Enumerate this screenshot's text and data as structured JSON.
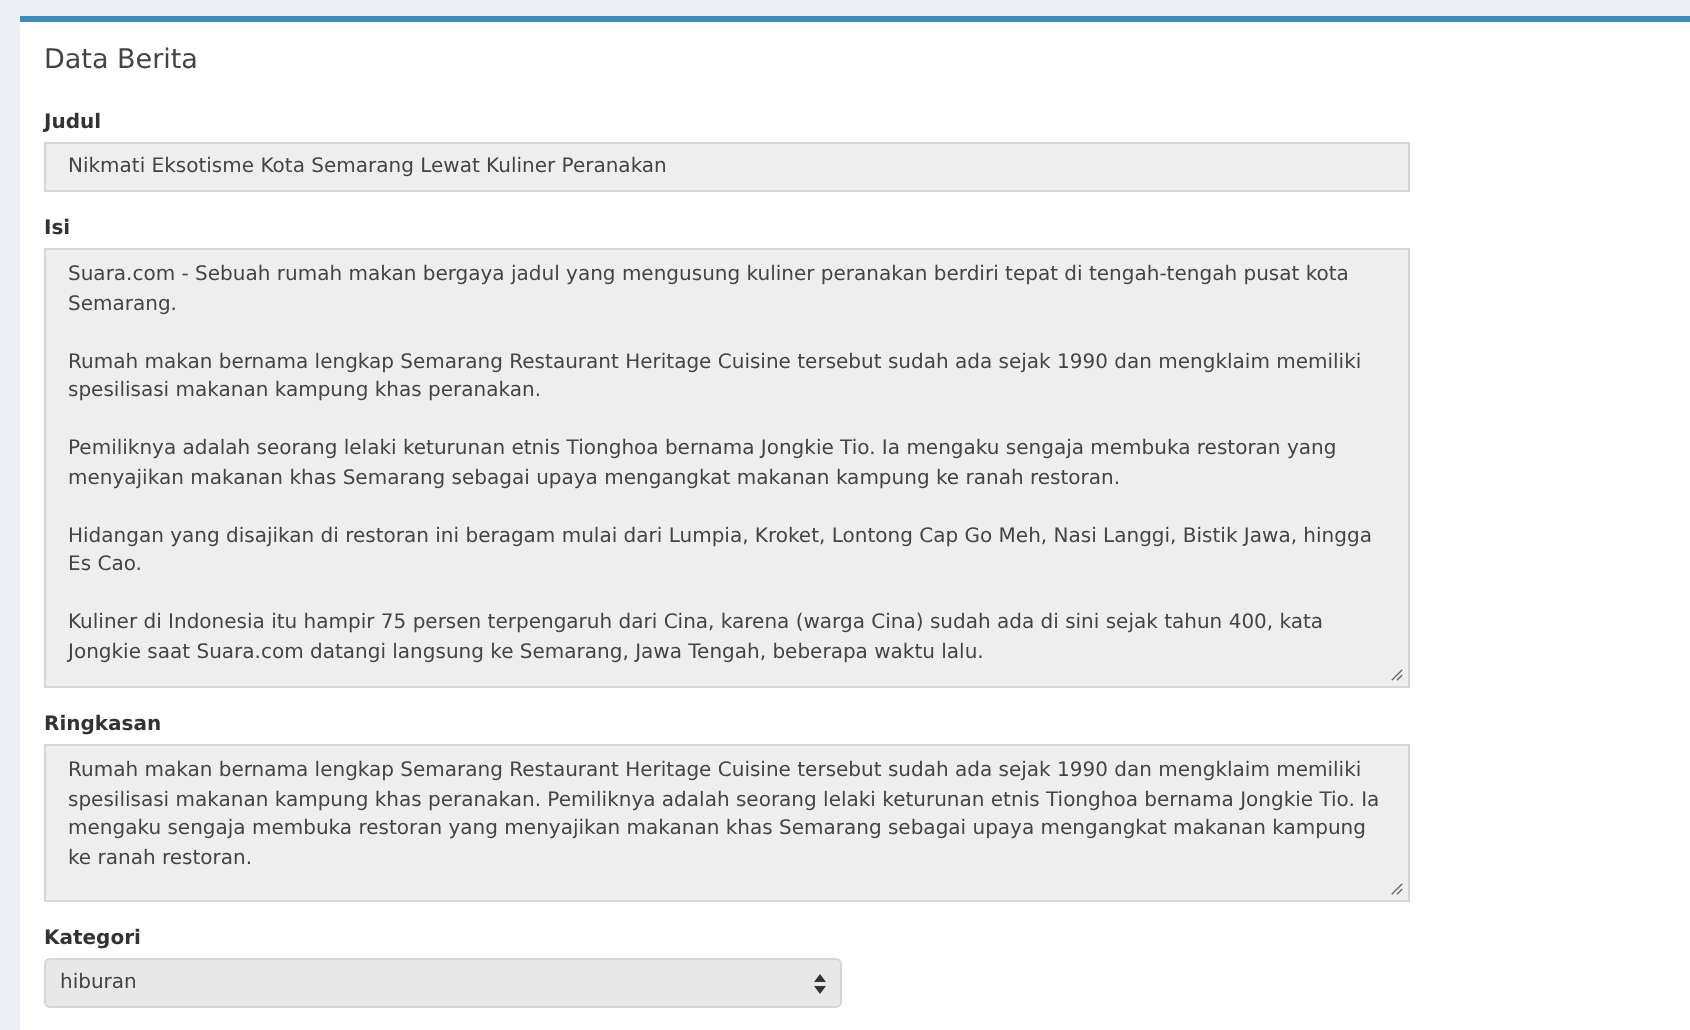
{
  "panel": {
    "title": "Data Berita"
  },
  "fields": [
    {
      "kind": "input",
      "label": "Judul",
      "value": "Nikmati Eksotisme Kota Semarang Lewat Kuliner Peranakan"
    },
    {
      "kind": "textarea",
      "label": "Isi",
      "paragraphs": [
        "Suara.com - Sebuah rumah makan bergaya jadul yang mengusung kuliner peranakan berdiri tepat di tengah-tengah pusat kota Semarang.",
        "Rumah makan bernama lengkap Semarang Restaurant Heritage Cuisine tersebut sudah ada sejak 1990 dan mengklaim memiliki spesilisasi makanan kampung khas peranakan.",
        "Pemiliknya adalah seorang lelaki keturunan etnis Tionghoa bernama Jongkie Tio. Ia mengaku sengaja membuka restoran yang menyajikan makanan khas Semarang sebagai upaya mengangkat makanan kampung ke ranah restoran.",
        "Hidangan yang disajikan di restoran ini beragam mulai dari Lumpia, Kroket, Lontong Cap Go Meh, Nasi Langgi, Bistik Jawa, hingga Es Cao.",
        "Kuliner di Indonesia itu hampir 75 persen terpengaruh dari Cina, karena (warga Cina) sudah ada di sini sejak tahun 400,  kata Jongkie saat Suara.com datangi langsung ke Semarang, Jawa Tengah, beberapa waktu lalu."
      ]
    },
    {
      "kind": "textarea",
      "label": "Ringkasan",
      "paragraphs": [
        "Rumah makan bernama lengkap Semarang Restaurant Heritage Cuisine tersebut sudah ada sejak 1990 dan mengklaim memiliki spesilisasi makanan kampung khas peranakan. Pemiliknya adalah seorang lelaki keturunan etnis Tionghoa bernama Jongkie Tio. Ia mengaku sengaja membuka restoran yang menyajikan makanan khas Semarang sebagai upaya mengangkat makanan kampung ke ranah restoran."
      ]
    },
    {
      "kind": "select",
      "label": "Kategori",
      "value": "hiburan"
    }
  ]
}
